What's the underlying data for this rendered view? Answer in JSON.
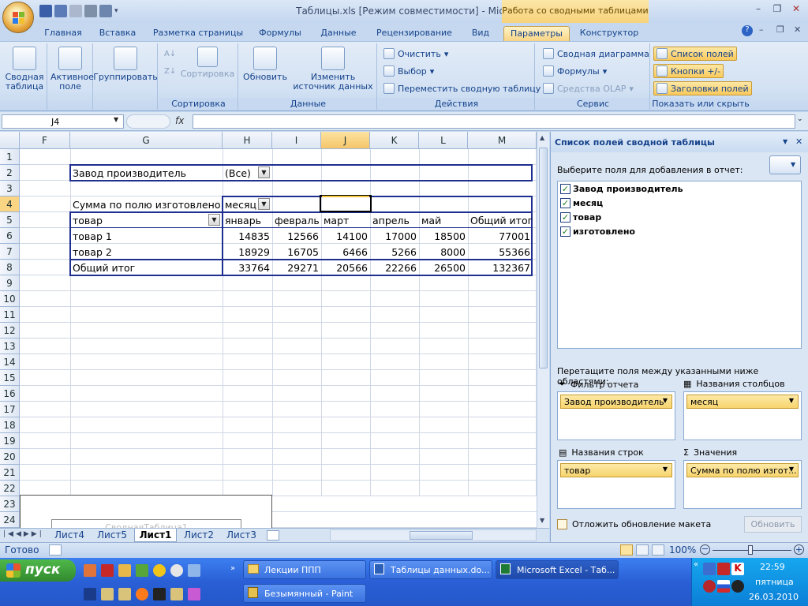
{
  "window": {
    "title": "Таблицы.xls  [Режим совместимости] - Microsoft Excel",
    "context_tab": "Работа со сводными таблицами"
  },
  "tabs": [
    "Главная",
    "Вставка",
    "Разметка страницы",
    "Формулы",
    "Данные",
    "Рецензирование",
    "Вид",
    "Параметры",
    "Конструктор"
  ],
  "active_tab": "Параметры",
  "ribbon": {
    "pivot_table": "Сводная таблица",
    "active_field": "Активное поле",
    "group": "Группировать",
    "sort_group_label": "Сортировка",
    "sort_btn": "Сортировка",
    "refresh": "Обновить",
    "change_source": "Изменить источник данных",
    "data_group_label": "Данные",
    "clear": "Очистить",
    "select": "Выбор",
    "move": "Переместить сводную таблицу",
    "actions_group_label": "Действия",
    "pivot_chart": "Сводная диаграмма",
    "formulas": "Формулы",
    "olap": "Средства OLAP",
    "service_group_label": "Сервис",
    "field_list": "Список полей",
    "buttons": "Кнопки +/-",
    "headers": "Заголовки полей",
    "show_group_label": "Показать или скрыть"
  },
  "formula_bar": {
    "name_box": "J4",
    "fx": "fx",
    "formula": ""
  },
  "columns": [
    "F",
    "G",
    "H",
    "I",
    "J",
    "K",
    "L",
    "M"
  ],
  "rows": [
    "1",
    "2",
    "3",
    "4",
    "5",
    "6",
    "7",
    "8",
    "9",
    "10",
    "11",
    "12",
    "13",
    "14",
    "15",
    "16",
    "17",
    "18",
    "19",
    "20",
    "21",
    "22",
    "23",
    "24"
  ],
  "cells": {
    "filter_label": "Завод производитель",
    "filter_value": "(Все)",
    "data_label": "Сумма по полю изготовлено",
    "col_field": "месяц",
    "row_field": "товар",
    "months": [
      "январь",
      "февраль",
      "март",
      "апрель",
      "май",
      "Общий итог"
    ],
    "row_items": [
      {
        "label": "товар 1",
        "values": [
          "14835",
          "12566",
          "14100",
          "17000",
          "18500",
          "77001"
        ]
      },
      {
        "label": "товар 2",
        "values": [
          "18929",
          "16705",
          "6466",
          "5266",
          "8000",
          "55366"
        ]
      },
      {
        "label": "Общий итог",
        "values": [
          "33764",
          "29271",
          "20566",
          "22266",
          "26500",
          "132367"
        ]
      }
    ],
    "pivot_placeholder": "СводнаяТаблица1"
  },
  "sheets": [
    "Лист4",
    "Лист5",
    "Лист1",
    "Лист2",
    "Лист3"
  ],
  "active_sheet": "Лист1",
  "status": {
    "ready": "Готово",
    "zoom": "100%"
  },
  "pane": {
    "title": "Список полей сводной таблицы",
    "choose": "Выберите поля для добавления в отчет:",
    "fields": [
      "Завод производитель",
      "месяц",
      "товар",
      "изготовлено"
    ],
    "drag": "Перетащите поля между указанными ниже областями:",
    "filter_area": "Фильтр отчета",
    "columns_area": "Названия столбцов",
    "rows_area": "Названия строк",
    "values_area": "Значения",
    "filter_chip": "Завод производитель",
    "columns_chip": "месяц",
    "rows_chip": "товар",
    "values_chip": "Сумма по полю изгот...",
    "defer": "Отложить обновление макета",
    "update": "Обновить"
  },
  "taskbar": {
    "start": "пуск",
    "items": [
      "Лекции ППП",
      "Таблицы данных.do...",
      "Microsoft Excel - Таб...",
      "Безымянный - Paint"
    ],
    "time": "22:59",
    "day": "пятница",
    "date": "26.03.2010"
  }
}
